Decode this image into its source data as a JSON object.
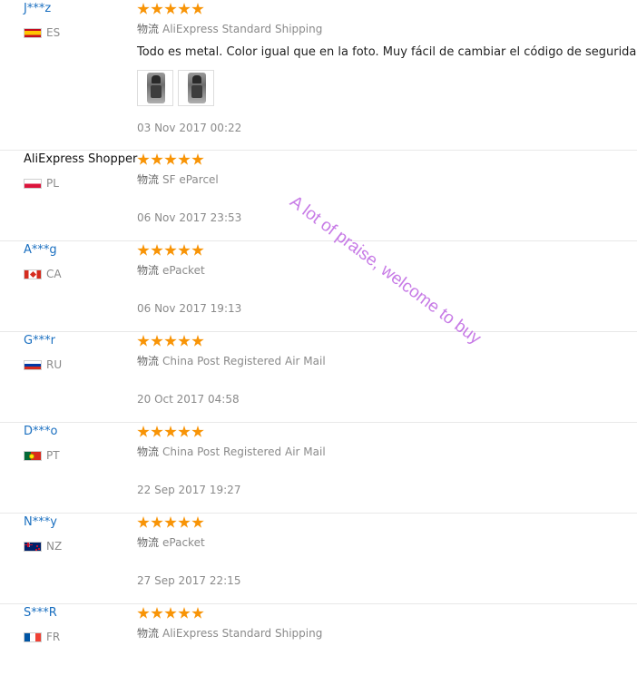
{
  "reviews": [
    {
      "name": "J***z",
      "name_style": "link",
      "country": "ES",
      "flag": "es-flag-icon",
      "rating": 5,
      "shipping_label": "物流",
      "shipping_method": "AliExpress Standard Shipping",
      "feedback": "Todo es metal. Color igual que en la foto. Muy fácil de cambiar el código de seguridad.",
      "photos": [
        "product-photo-icon",
        "product-photo-icon"
      ],
      "date": "03 Nov 2017 00:22"
    },
    {
      "name": "AliExpress Shopper",
      "name_style": "plain",
      "country": "PL",
      "flag": "pl-flag-icon",
      "rating": 5,
      "shipping_label": "物流",
      "shipping_method": "SF eParcel",
      "date": "06 Nov 2017 23:53"
    },
    {
      "name": "A***g",
      "name_style": "link",
      "country": "CA",
      "flag": "ca-flag-icon",
      "rating": 5,
      "shipping_label": "物流",
      "shipping_method": "ePacket",
      "date": "06 Nov 2017 19:13"
    },
    {
      "name": "G***r",
      "name_style": "link",
      "country": "RU",
      "flag": "ru-flag-icon",
      "rating": 5,
      "shipping_label": "物流",
      "shipping_method": "China Post Registered Air Mail",
      "date": "20 Oct 2017 04:58"
    },
    {
      "name": "D***o",
      "name_style": "link",
      "country": "PT",
      "flag": "pt-flag-icon",
      "rating": 5,
      "shipping_label": "物流",
      "shipping_method": "China Post Registered Air Mail",
      "date": "22 Sep 2017 19:27"
    },
    {
      "name": "N***y",
      "name_style": "link",
      "country": "NZ",
      "flag": "nz-flag-icon",
      "rating": 5,
      "shipping_label": "物流",
      "shipping_method": "ePacket",
      "date": "27 Sep 2017 22:15"
    },
    {
      "name": "S***R",
      "name_style": "link",
      "country": "FR",
      "flag": "fr-flag-icon",
      "rating": 5,
      "shipping_label": "物流",
      "shipping_method": "AliExpress Standard Shipping"
    }
  ],
  "watermark": "A lot of praise, welcome to buy",
  "colors": {
    "star": "#f89406",
    "link": "#1a6fc0",
    "meta_text": "#8a8a8a",
    "watermark": "#c77be6",
    "divider": "#e8e8e8"
  }
}
